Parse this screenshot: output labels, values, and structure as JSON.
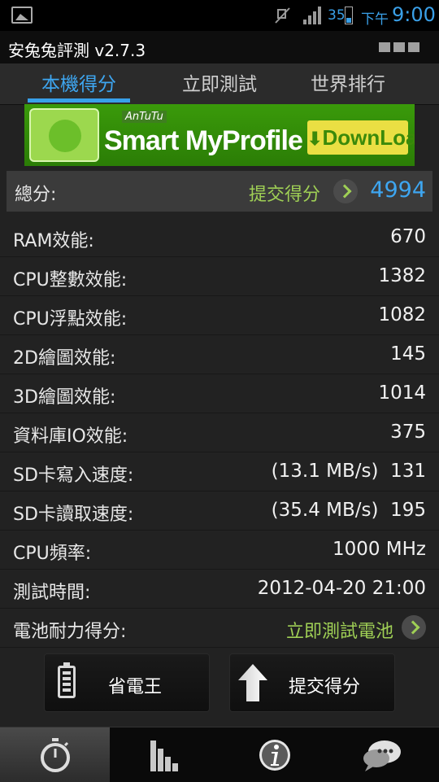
{
  "status_bar": {
    "icons": [
      "image-icon",
      "mute-icon",
      "signal-icon",
      "battery-icon"
    ],
    "battery_level": "35",
    "ampm": "下午",
    "time": "9:00"
  },
  "title_bar": {
    "title": "安兔兔評測 v2.7.3",
    "menu_icon": "overflow-menu-icon"
  },
  "tabs": [
    {
      "label": "本機得分",
      "active": true
    },
    {
      "label": "立即測試",
      "active": false
    },
    {
      "label": "世界排行",
      "active": false
    }
  ],
  "banner": {
    "brand": "AnTuTu",
    "headline": "Smart MyProfile",
    "download_label": "DownLoad"
  },
  "total": {
    "label": "總分:",
    "submit_label": "提交得分",
    "value": "4994"
  },
  "scores": [
    {
      "label": "RAM效能:",
      "value": "670"
    },
    {
      "label": "CPU整數效能:",
      "value": "1382"
    },
    {
      "label": "CPU浮點效能:",
      "value": "1082"
    },
    {
      "label": "2D繪圖效能:",
      "value": "145"
    },
    {
      "label": "3D繪圖效能:",
      "value": "1014"
    },
    {
      "label": "資料庫IO效能:",
      "value": "375"
    },
    {
      "label": "SD卡寫入速度:",
      "value": "(13.1 MB/s)  131"
    },
    {
      "label": "SD卡讀取速度:",
      "value": "(35.4 MB/s)  195"
    },
    {
      "label": "CPU頻率:",
      "value": "1000 MHz"
    },
    {
      "label": "測試時間:",
      "value": "2012-04-20 21:00"
    }
  ],
  "battery": {
    "label": "電池耐力得分:",
    "link": "立即測試電池"
  },
  "actions": {
    "power_saver": "省電王",
    "submit": "提交得分"
  },
  "bottom_nav": [
    {
      "icon": "stopwatch-icon",
      "active": true
    },
    {
      "icon": "bar-chart-icon",
      "active": false
    },
    {
      "icon": "info-icon",
      "active": false
    },
    {
      "icon": "chat-icon",
      "active": false
    }
  ],
  "colors": {
    "accent_blue": "#3ea6f0",
    "link_green": "#9fcf55",
    "background": "#222222"
  }
}
